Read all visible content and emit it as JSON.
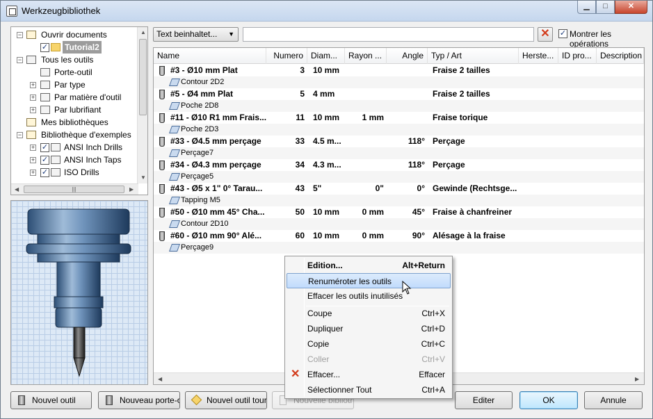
{
  "window": {
    "title": "Werkzeugbibliothek"
  },
  "tree": {
    "items": [
      {
        "label": "Ouvrir documents"
      },
      {
        "label": "Tutorial2"
      },
      {
        "label": "Tous les outils"
      },
      {
        "label": "Porte-outil"
      },
      {
        "label": "Par type"
      },
      {
        "label": "Par matière d'outil"
      },
      {
        "label": "Par lubrifiant"
      },
      {
        "label": "Mes bibliothèques"
      },
      {
        "label": "Bibliothèque d'exemples"
      },
      {
        "label": "ANSI Inch Drills"
      },
      {
        "label": "ANSI Inch Taps"
      },
      {
        "label": "ISO Drills"
      }
    ]
  },
  "filter": {
    "mode": "Text beinhaltet...",
    "text": "",
    "show_ops_label": "Montrer les opérations"
  },
  "columns": [
    "Name",
    "Numero",
    "Diam...",
    "Rayon ...",
    "Angle",
    "Typ / Art",
    "Herste...",
    "ID pro...",
    "Description"
  ],
  "tools": [
    {
      "name": "#3 - Ø10 mm Plat",
      "numero": "3",
      "diam": "10 mm",
      "rayon": "",
      "angle": "",
      "type": "Fraise 2 tailles",
      "op": "Contour 2D2"
    },
    {
      "name": "#5 - Ø4 mm Plat",
      "numero": "5",
      "diam": "4 mm",
      "rayon": "",
      "angle": "",
      "type": "Fraise 2 tailles",
      "op": "Poche 2D8"
    },
    {
      "name": "#11 - Ø10 R1 mm Frais...",
      "numero": "11",
      "diam": "10 mm",
      "rayon": "1 mm",
      "angle": "",
      "type": "Fraise torique",
      "op": "Poche 2D3"
    },
    {
      "name": "#33 - Ø4.5 mm perçage",
      "numero": "33",
      "diam": "4.5 m...",
      "rayon": "",
      "angle": "118°",
      "type": "Perçage",
      "op": "Perçage7"
    },
    {
      "name": "#34 - Ø4.3 mm perçage",
      "numero": "34",
      "diam": "4.3 m...",
      "rayon": "",
      "angle": "118°",
      "type": "Perçage",
      "op": "Perçage5"
    },
    {
      "name": "#43 - Ø5 x 1\" 0° Tarau...",
      "numero": "43",
      "diam": "5\"",
      "rayon": "0\"",
      "angle": "0°",
      "type": "Gewinde (Rechtsge...",
      "op": "Tapping M5"
    },
    {
      "name": "#50 - Ø10 mm 45° Cha...",
      "numero": "50",
      "diam": "10 mm",
      "rayon": "0 mm",
      "angle": "45°",
      "type": "Fraise à chanfreiner",
      "op": "Contour 2D10"
    },
    {
      "name": "#60 - Ø10 mm 90° Alé...",
      "numero": "60",
      "diam": "10 mm",
      "rayon": "0 mm",
      "angle": "90°",
      "type": "Alésage à la fraise",
      "op": "Perçage9"
    }
  ],
  "buttons": {
    "new_tool": "Nouvel outil",
    "new_holder": "Nouveau porte-ou",
    "new_turning": "Nouvel outil tourna",
    "new_library": "Nouvelle bibliothèq",
    "edit": "Editer",
    "ok": "OK",
    "cancel": "Annule"
  },
  "menu": {
    "items": [
      {
        "label": "Edition...",
        "key": "Alt+Return"
      },
      {
        "label": "Renuméroter les outils",
        "key": ""
      },
      {
        "label": "Effacer les outils inutilisés",
        "key": ""
      },
      {
        "label": "Coupe",
        "key": "Ctrl+X"
      },
      {
        "label": "Dupliquer",
        "key": "Ctrl+D"
      },
      {
        "label": "Copie",
        "key": "Ctrl+C"
      },
      {
        "label": "Coller",
        "key": "Ctrl+V"
      },
      {
        "label": "Effacer...",
        "key": "Effacer"
      },
      {
        "label": "Sélectionner Tout",
        "key": "Ctrl+A"
      }
    ]
  }
}
